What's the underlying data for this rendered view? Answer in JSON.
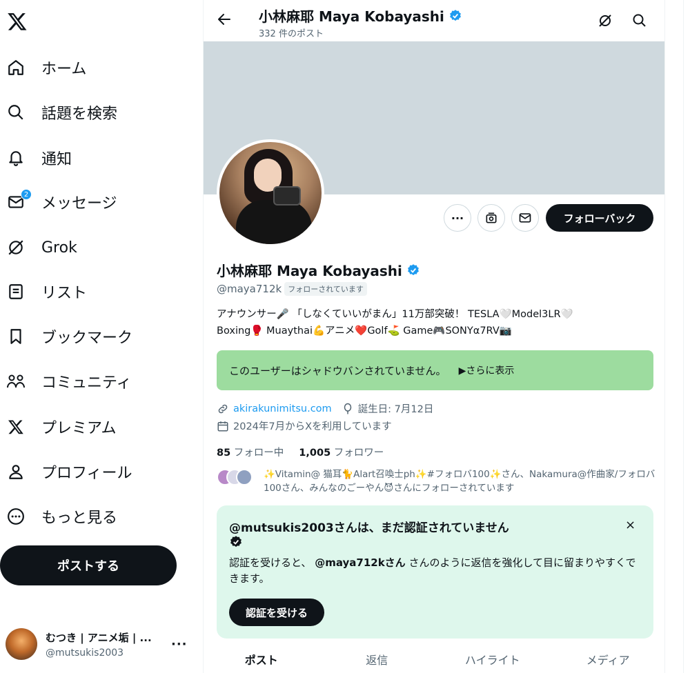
{
  "sidebar": {
    "items": [
      {
        "label": "ホーム",
        "icon": "home-icon"
      },
      {
        "label": "話題を検索",
        "icon": "search-icon"
      },
      {
        "label": "通知",
        "icon": "bell-icon"
      },
      {
        "label": "メッセージ",
        "icon": "mail-icon",
        "badge": "2"
      },
      {
        "label": "Grok",
        "icon": "grok-icon"
      },
      {
        "label": "リスト",
        "icon": "list-icon"
      },
      {
        "label": "ブックマーク",
        "icon": "bookmark-icon"
      },
      {
        "label": "コミュニティ",
        "icon": "community-icon"
      },
      {
        "label": "プレミアム",
        "icon": "x-logo-icon"
      },
      {
        "label": "プロフィール",
        "icon": "person-icon"
      },
      {
        "label": "もっと見る",
        "icon": "more-circle-icon"
      }
    ],
    "post_label": "ポストする",
    "account": {
      "name": "むつき | アニメ垢 | ...",
      "handle": "@mutsukis2003",
      "more": "···"
    }
  },
  "header": {
    "name": "小林麻耶 Maya Kobayashi",
    "post_count": "332 件のポスト"
  },
  "profile": {
    "name": "小林麻耶 Maya Kobayashi",
    "handle": "@maya712k",
    "follows_you": "フォローされています",
    "follow_back_label": "フォローバック",
    "more_label": "···",
    "bio_line1": "アナウンサー🎤 「しなくていいがまん」11万部突破！ TESLA🤍Model3LR🤍",
    "bio_line2": "Boxing🥊 Muaythai💪アニメ❤️Golf⛳ Game🎮SONYα7RV📷",
    "shadowban_text": "このユーザーはシャドウバンされていません。",
    "shadowban_more": "▶さらに表示",
    "website": "akirakunimitsu.com",
    "birthday": "誕生日: 7月12日",
    "joined": "2024年7月からXを利用しています",
    "following_count": "85",
    "following_label": "フォロー中",
    "followers_count": "1,005",
    "followers_label": "フォロワー",
    "known_followers": "✨Vitamin@ 猫耳🐈Alart召喚士ph✨#フォロバ100✨さん、Nakamura@作曲家/フォロバ100さん、みんなのごーやん😈さんにフォローされています"
  },
  "verify_card": {
    "title": "@mutsukis2003さんは、まだ認証されていません",
    "close": "×",
    "body_prefix": "認証を受けると、",
    "body_handle": "@maya712kさん",
    "body_suffix": "さんのように返信を強化して目に留まりやすくできます。",
    "button_label": "認証を受ける"
  },
  "tabs": [
    {
      "label": "ポスト",
      "active": true
    },
    {
      "label": "返信",
      "active": false
    },
    {
      "label": "ハイライト",
      "active": false
    },
    {
      "label": "メディア",
      "active": false
    }
  ],
  "colors": {
    "accent": "#1d9bf0",
    "shadowban_bg": "#9ddc9f",
    "verify_bg": "#def7ec",
    "banner": "#cfd9de"
  }
}
